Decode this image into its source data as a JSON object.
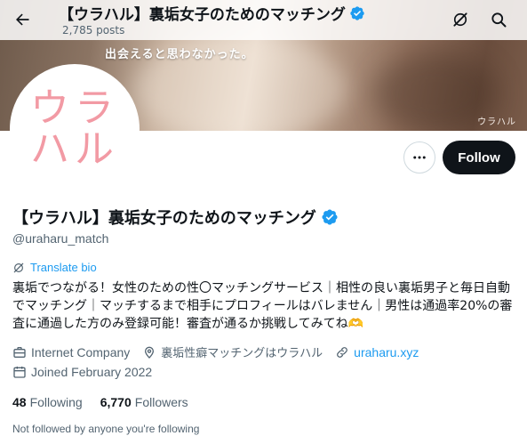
{
  "header": {
    "title": "【ウラハル】裏垢女子のためのマッチング",
    "posts_count": "2,785 posts"
  },
  "banner": {
    "tagline": "出会えると思わなかった。",
    "logo_text": "ウラハル"
  },
  "avatar": {
    "line1": "ウラ",
    "line2": "ハル",
    "color": "#f29aa4"
  },
  "actions": {
    "follow_label": "Follow"
  },
  "profile": {
    "display_name": "【ウラハル】裏垢女子のためのマッチング",
    "handle": "@uraharu_match",
    "translate_label": "Translate bio",
    "bio": "裏垢でつながる！女性のための性〇マッチングサービス｜相性の良い裏垢男子と毎日自動でマッチング｜マッチするまで相手にプロフィールはバレません｜男性は通過率20%の審査に通過した方のみ登録可能！審査が通るか挑戦してみてね🫶",
    "category": "Internet Company",
    "location": "裏垢性癖マッチングはウラハル",
    "website": "uraharu.xyz",
    "joined": "Joined February 2022"
  },
  "stats": {
    "following_count": "48",
    "following_label": "Following",
    "followers_count": "6,770",
    "followers_label": "Followers"
  },
  "footer_note": "Not followed by anyone you're following",
  "colors": {
    "accent": "#1d9bf0",
    "verified": "#1d9bf0",
    "follow_button_bg": "#0f1419",
    "secondary_text": "#536471"
  },
  "icons": {
    "back": "arrow-left-icon",
    "grok": "grok-icon",
    "search": "search-icon",
    "more": "more-dots-icon",
    "verified": "verified-badge-icon",
    "translate": "translate-icon",
    "category": "briefcase-icon",
    "location": "location-pin-icon",
    "website": "link-icon",
    "joined": "calendar-icon"
  }
}
